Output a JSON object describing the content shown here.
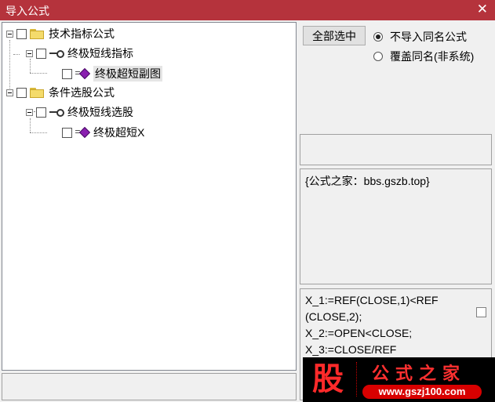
{
  "window": {
    "title": "导入公式",
    "close_glyph": "✕"
  },
  "tree": {
    "nodes": [
      {
        "label": "技术指标公式",
        "icon": "folder-icon"
      },
      {
        "label": "终极短线指标",
        "icon": "key-icon"
      },
      {
        "label": "终极超短副图",
        "icon": "gem-icon",
        "selected": true
      },
      {
        "label": "条件选股公式",
        "icon": "folder-icon"
      },
      {
        "label": "终极短线选股",
        "icon": "key-icon"
      },
      {
        "label": "终极超短X",
        "icon": "gem-icon"
      }
    ]
  },
  "controls": {
    "select_all_label": "全部选中",
    "radio_no_import": "不导入同名公式",
    "radio_overwrite": "覆盖同名(非系统)",
    "radio_selected": "no_import"
  },
  "description": "{公式之家：bbs.gszb.top}",
  "code_lines": [
    "X_1:=REF(CLOSE,1)<REF",
    "(CLOSE,2);",
    "X_2:=OPEN<CLOSE;",
    "X_3:=CLOSE/REF"
  ],
  "banner": {
    "glyph": "股",
    "slogan": "公式之家",
    "url": "www.gszj100.com",
    "accent_color": "#ff2a2a"
  }
}
